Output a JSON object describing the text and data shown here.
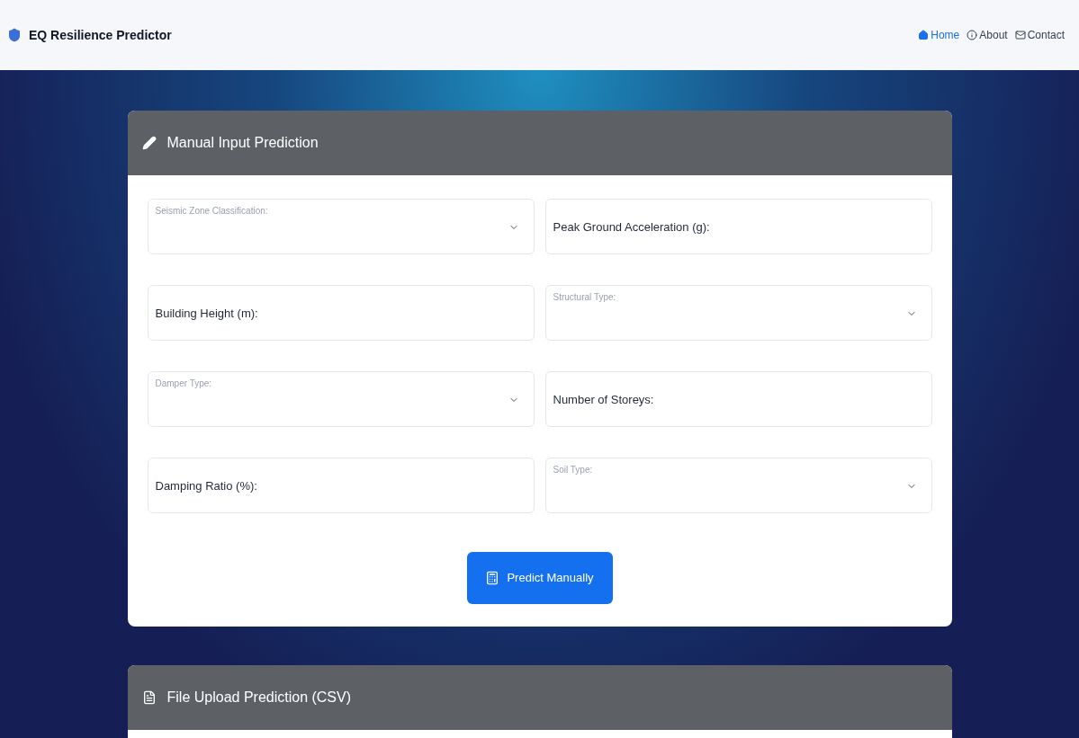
{
  "navbar": {
    "brand": "EQ Resilience Predictor",
    "links": [
      {
        "label": "Home",
        "kind": "home",
        "selected": true
      },
      {
        "label": "About",
        "kind": "info",
        "selected": false
      },
      {
        "label": "Contact",
        "kind": "mail",
        "selected": false
      }
    ]
  },
  "manual_card": {
    "title": "Manual Input Prediction",
    "fields": [
      {
        "kind": "select",
        "label": "Seismic Zone Classification:"
      },
      {
        "kind": "input",
        "placeholder": "Peak Ground Acceleration (g):"
      },
      {
        "kind": "input",
        "placeholder": "Building Height (m):"
      },
      {
        "kind": "select",
        "label": "Structural Type:"
      },
      {
        "kind": "select",
        "label": "Damper Type:"
      },
      {
        "kind": "input",
        "placeholder": "Number of Storeys:"
      },
      {
        "kind": "input",
        "placeholder": "Damping Ratio (%):"
      },
      {
        "kind": "select",
        "label": "Soil Type:"
      }
    ],
    "button": "Predict Manually"
  },
  "upload_card": {
    "title": "File Upload Prediction (CSV)"
  }
}
